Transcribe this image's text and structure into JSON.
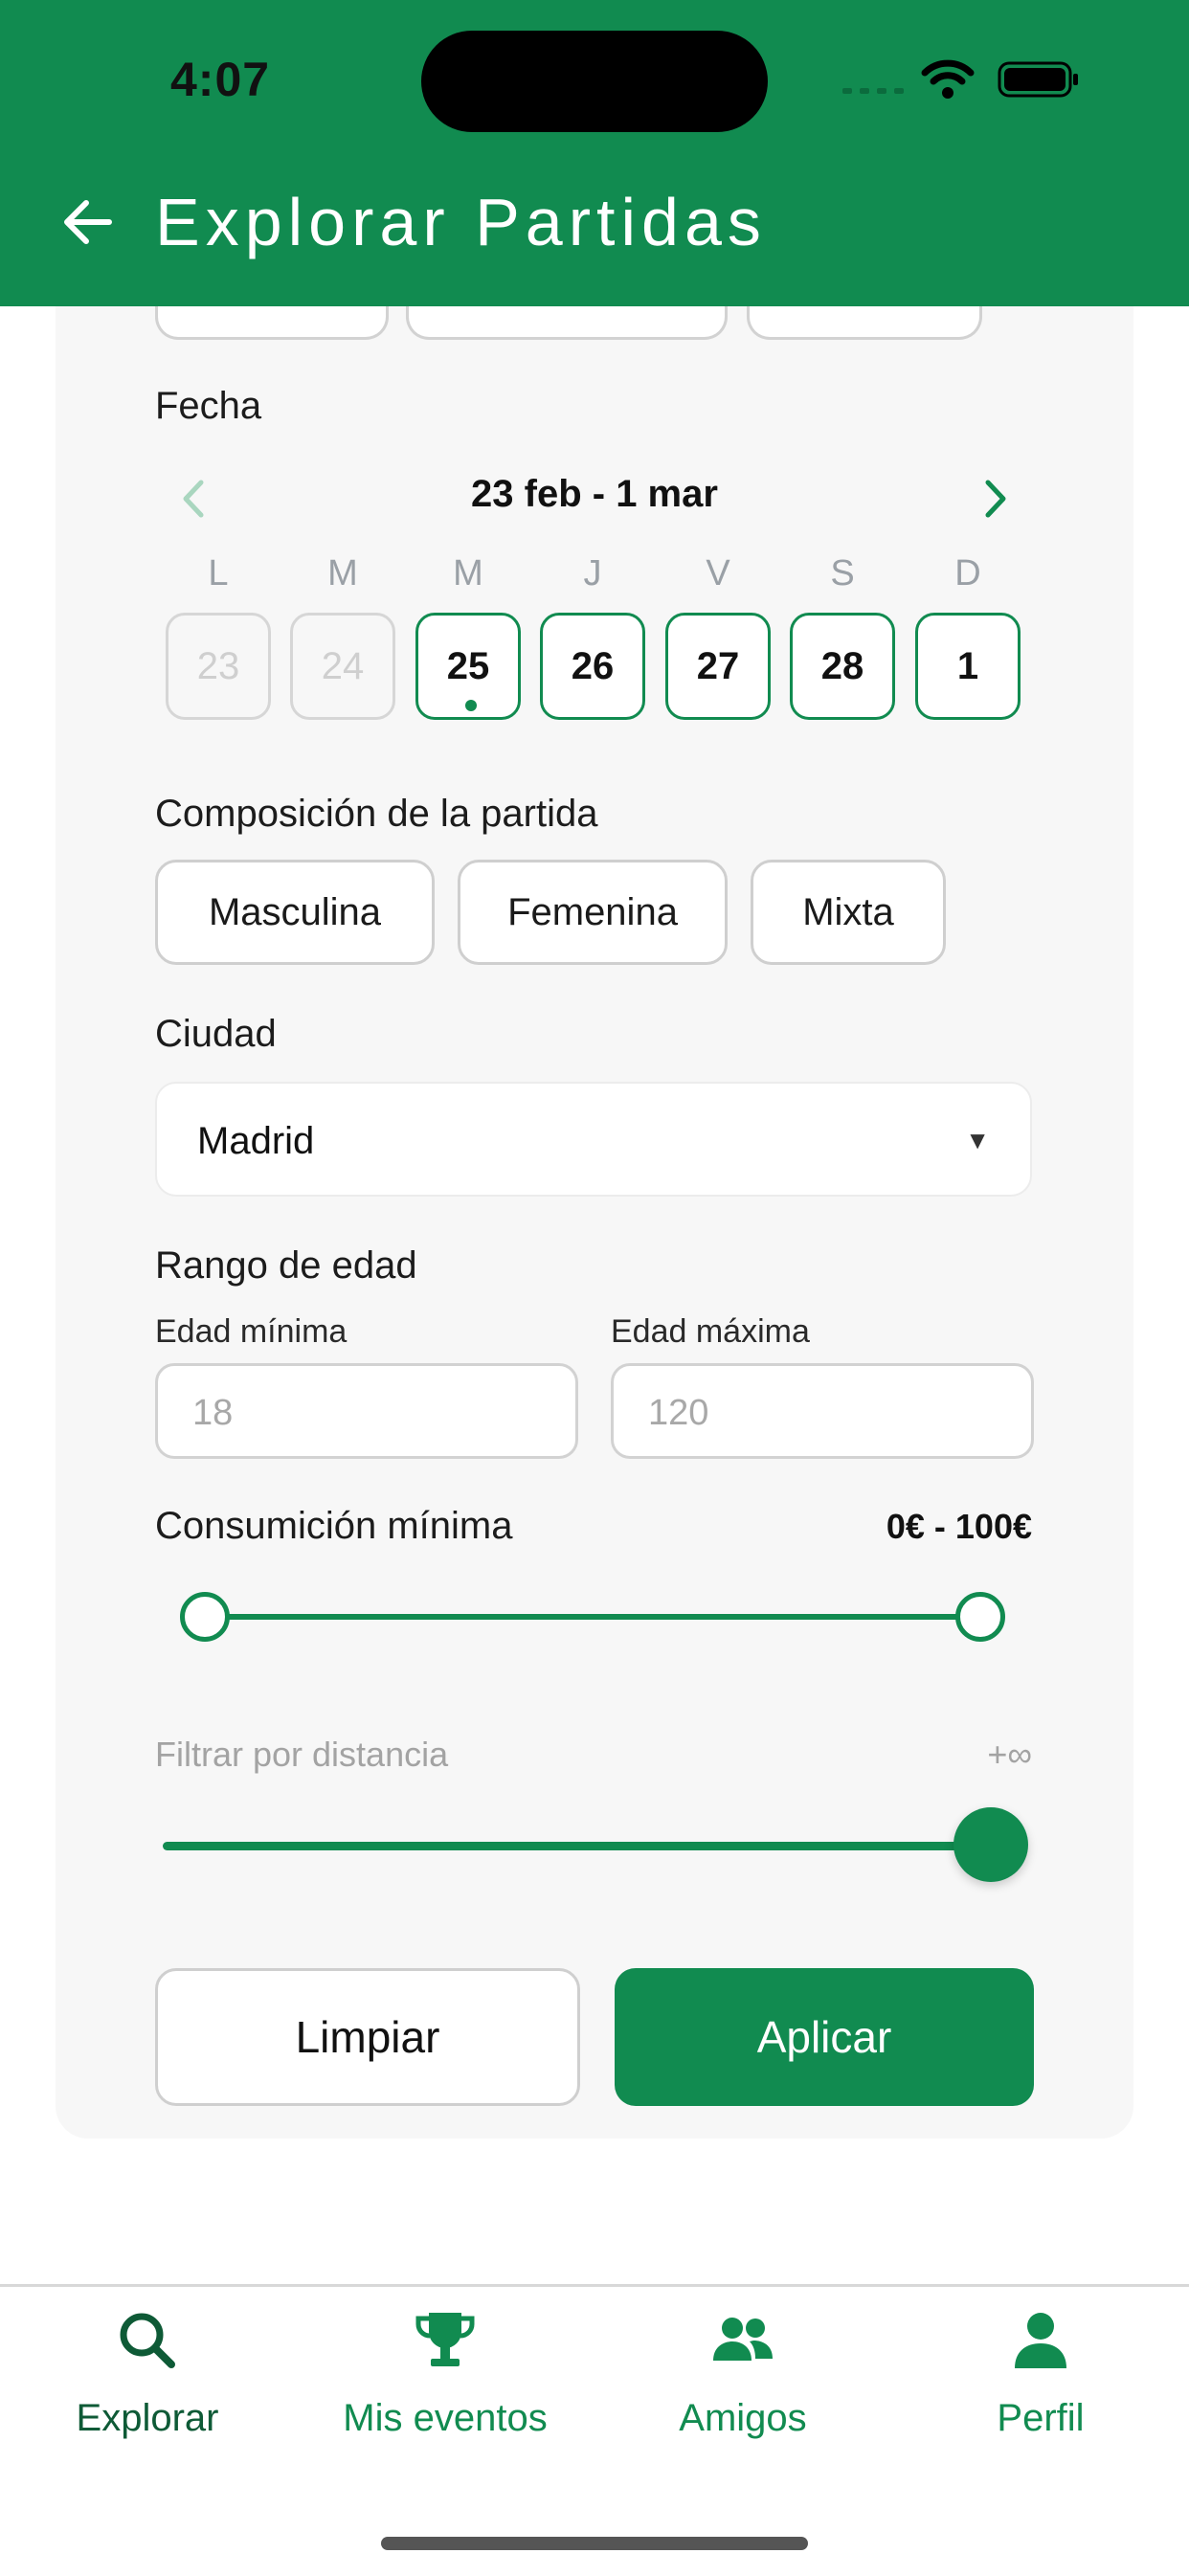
{
  "status_bar": {
    "time": "4:07"
  },
  "header": {
    "title": "Explorar Partidas"
  },
  "date_section": {
    "label": "Fecha",
    "week_range": "23 feb - 1 mar",
    "weekdays": [
      "L",
      "M",
      "M",
      "J",
      "V",
      "S",
      "D"
    ],
    "days": [
      {
        "num": "23",
        "enabled": false
      },
      {
        "num": "24",
        "enabled": false
      },
      {
        "num": "25",
        "enabled": true,
        "today": true
      },
      {
        "num": "26",
        "enabled": true
      },
      {
        "num": "27",
        "enabled": true
      },
      {
        "num": "28",
        "enabled": true
      },
      {
        "num": "1",
        "enabled": true
      }
    ]
  },
  "composition": {
    "label": "Composición de la partida",
    "options": [
      "Masculina",
      "Femenina",
      "Mixta"
    ]
  },
  "city": {
    "label": "Ciudad",
    "value": "Madrid"
  },
  "age_range": {
    "label": "Rango de edad",
    "min_label": "Edad mínima",
    "min_placeholder": "18",
    "max_label": "Edad máxima",
    "max_placeholder": "120"
  },
  "consumption": {
    "label": "Consumición mínima",
    "range_text": "0€ - 100€",
    "min": 0,
    "max": 100,
    "low": 0,
    "high": 100
  },
  "distance": {
    "label": "Filtrar por distancia",
    "value_text": "+∞",
    "level": 1.0
  },
  "actions": {
    "clear": "Limpiar",
    "apply": "Aplicar"
  },
  "tabs": [
    {
      "label": "Explorar",
      "icon": "search-icon",
      "active": true
    },
    {
      "label": "Mis eventos",
      "icon": "trophy-icon",
      "active": false
    },
    {
      "label": "Amigos",
      "icon": "people-icon",
      "active": false
    },
    {
      "label": "Perfil",
      "icon": "person-icon",
      "active": false
    }
  ],
  "colors": {
    "brand": "#118b50",
    "brand_dark": "#0e5a36"
  }
}
